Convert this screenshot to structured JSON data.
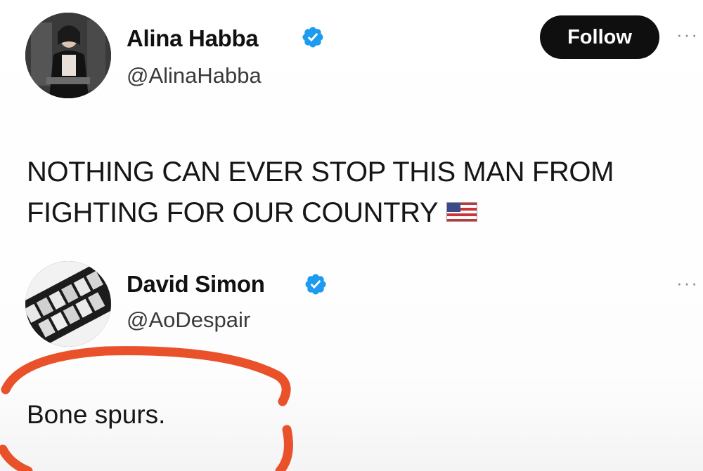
{
  "original_tweet": {
    "author_name": "Alina Habba",
    "handle": "@AlinaHabba",
    "follow_label": "Follow",
    "more_label": "···",
    "text": "NOTHING CAN EVER STOP THIS MAN FROM FIGHTING FOR OUR COUNTRY",
    "emoji": "flag-us-icon"
  },
  "reply": {
    "author_name": "David Simon",
    "handle": "@AoDespair",
    "more_label": "···",
    "text": "Bone spurs."
  },
  "colors": {
    "verified_blue": "#1d9bf0",
    "button_bg": "#0f0f0f",
    "highlight_circle": "#e8512a"
  }
}
